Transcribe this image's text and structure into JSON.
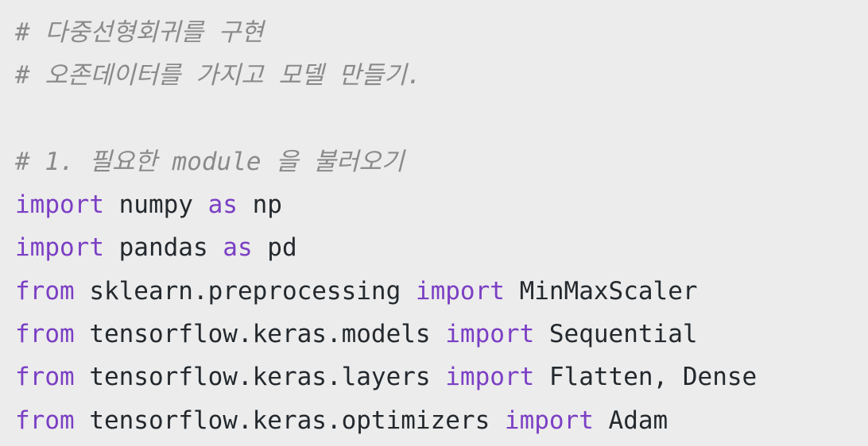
{
  "colors": {
    "background": "#ececec",
    "keyword": "#7b3fc4",
    "comment": "#8a8a8a",
    "text": "#24292e"
  },
  "code": {
    "comment1": "# 다중선형회귀를 구현",
    "comment2": "# 오존데이터를 가지고 모델 만들기.",
    "comment3": "# 1. 필요한 module 을 불러오기",
    "l4": {
      "kw1": "import",
      "mod": " numpy ",
      "kw2": "as",
      "alias": " np"
    },
    "l5": {
      "kw1": "import",
      "mod": " pandas ",
      "kw2": "as",
      "alias": " pd"
    },
    "l6": {
      "kw1": "from",
      "mod": " sklearn.preprocessing ",
      "kw2": "import",
      "names": " MinMaxScaler"
    },
    "l7": {
      "kw1": "from",
      "mod": " tensorflow.keras.models ",
      "kw2": "import",
      "names": " Sequential"
    },
    "l8": {
      "kw1": "from",
      "mod": " tensorflow.keras.layers ",
      "kw2": "import",
      "names": " Flatten, Dense"
    },
    "l9": {
      "kw1": "from",
      "mod": " tensorflow.keras.optimizers ",
      "kw2": "import",
      "names": " Adam"
    }
  }
}
